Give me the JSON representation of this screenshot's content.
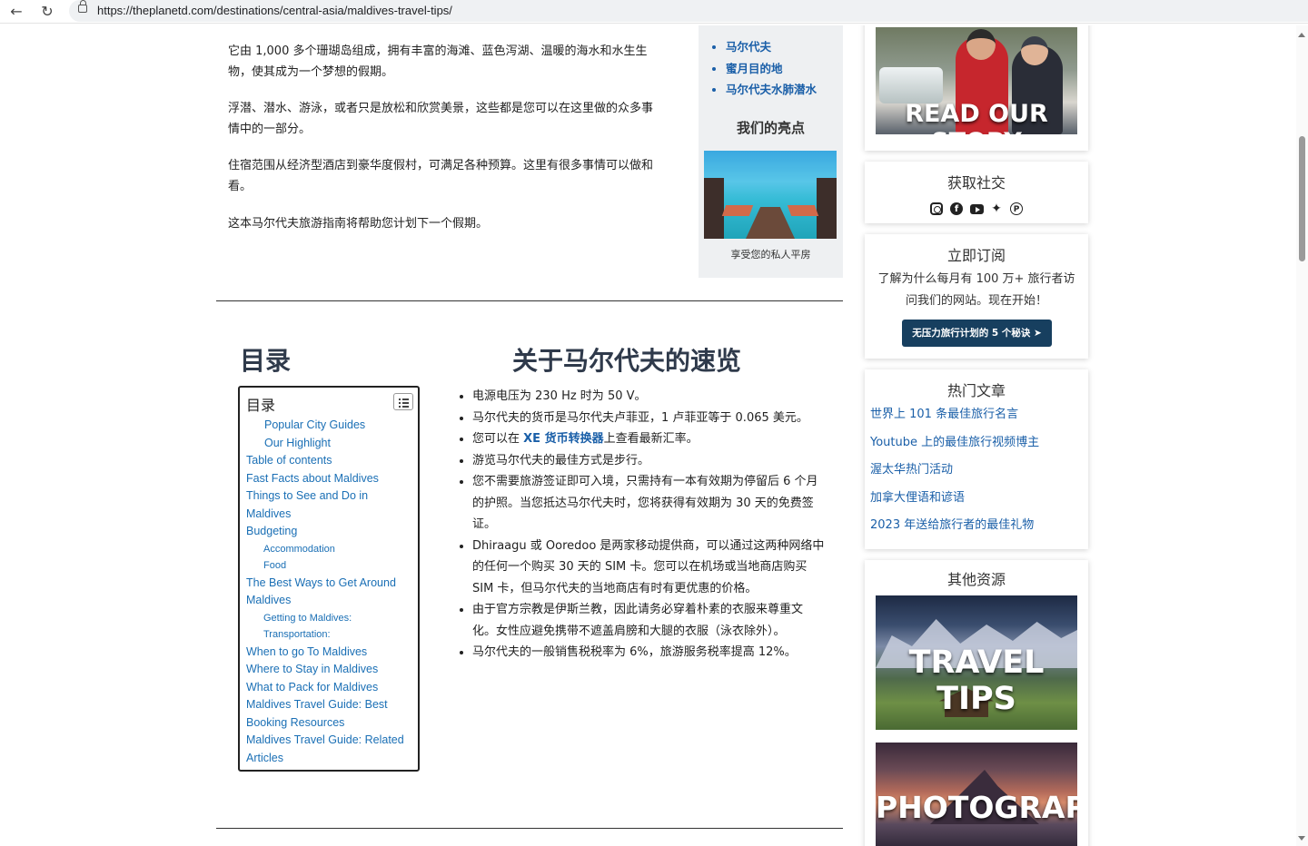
{
  "browser": {
    "url": "https://theplanetd.com/destinations/central-asia/maldives-travel-tips/",
    "back_icon": "arrow-left",
    "reload_icon": "reload"
  },
  "intro": {
    "paragraphs": [
      "它由 1,000 多个珊瑚岛组成，拥有丰富的海滩、蓝色泻湖、温暖的海水和水生生物，使其成为一个梦想的假期。",
      "浮潜、潜水、游泳，或者只是放松和欣赏美景，这些都是您可以在这里做的众多事情中的一部分。",
      "住宿范围从经济型酒店到豪华度假村，可满足各种预算。这里有很多事情可以做和看。",
      "这本马尔代夫旅游指南将帮助您计划下一个假期。"
    ]
  },
  "highlight": {
    "links": [
      "马尔代夫",
      "蜜月目的地",
      "马尔代夫水肺潜水"
    ],
    "title": "我们的亮点",
    "caption": "享受您的私人平房"
  },
  "toc": {
    "heading": "目录",
    "box_title": "目录",
    "items": [
      {
        "label": "Popular City Guides",
        "level": 2
      },
      {
        "label": "Our Highlight",
        "level": 2
      },
      {
        "label": "Table of contents",
        "level": 1
      },
      {
        "label": "Fast Facts about Maldives",
        "level": 1
      },
      {
        "label": "Things to See and Do in Maldives",
        "level": 1
      },
      {
        "label": "Budgeting",
        "level": 1
      },
      {
        "label": "Accommodation",
        "level": 3
      },
      {
        "label": "Food",
        "level": 3
      },
      {
        "label": "The Best Ways to Get Around Maldives",
        "level": 1
      },
      {
        "label": "Getting to Maldives:",
        "level": 3
      },
      {
        "label": "Transportation:",
        "level": 3
      },
      {
        "label": "When to go To Maldives",
        "level": 1
      },
      {
        "label": "Where to Stay in Maldives",
        "level": 1
      },
      {
        "label": "What to Pack for Maldives",
        "level": 1
      },
      {
        "label": "Maldives Travel Guide: Best Booking Resources",
        "level": 1
      },
      {
        "label": "Maldives Travel Guide: Related Articles",
        "level": 1
      }
    ]
  },
  "quick_facts": {
    "heading": "关于马尔代夫的速览",
    "items": [
      {
        "text": "电源电压为 230 Hz 时为 50 V。"
      },
      {
        "text": "马尔代夫的货币是马尔代夫卢菲亚，1 卢菲亚等于 0.065 美元。"
      },
      {
        "pre": "您可以在 ",
        "link": "XE 货币转换器",
        "post": "上查看最新汇率。"
      },
      {
        "text": "游览马尔代夫的最佳方式是步行。"
      },
      {
        "text": "您不需要旅游签证即可入境，只需持有一本有效期为停留后 6 个月的护照。当您抵达马尔代夫时，您将获得有效期为 30 天的免费签证。"
      },
      {
        "text": "Dhiraagu 或 Ooredoo 是两家移动提供商，可以通过这两种网络中的任何一个购买 30 天的 SIM 卡。您可以在机场或当地商店购买 SIM 卡，但马尔代夫的当地商店有时有更优惠的价格。"
      },
      {
        "text": "由于官方宗教是伊斯兰教，因此请务必穿着朴素的衣服来尊重文化。女性应避免携带不遮盖肩膀和大腿的衣服（泳衣除外）。"
      },
      {
        "text": "马尔代夫的一般销售税税率为 6%，旅游服务税率提高 12%。"
      }
    ]
  },
  "sidebar": {
    "story_banner": "READ OUR STORY",
    "social_title": "获取社交",
    "social_icons": [
      "instagram-icon",
      "facebook-icon",
      "youtube-icon",
      "twitter-icon",
      "pinterest-icon"
    ],
    "subscribe": {
      "title": "立即订阅",
      "text": "了解为什么每月有 100 万+ 旅行者访问我们的网站。现在开始！",
      "button": "无压力旅行计划的 5 个秘诀"
    },
    "popular": {
      "title": "热门文章",
      "items": [
        "世界上 101 条最佳旅行名言",
        "Youtube 上的最佳旅行视频博主",
        "渥太华热门活动",
        "加拿大俚语和谚语",
        "2023 年送给旅行者的最佳礼物"
      ]
    },
    "resources": {
      "title": "其他资源",
      "banners": [
        "TRAVEL TIPS",
        "PHOTOGRAPHY"
      ]
    }
  }
}
